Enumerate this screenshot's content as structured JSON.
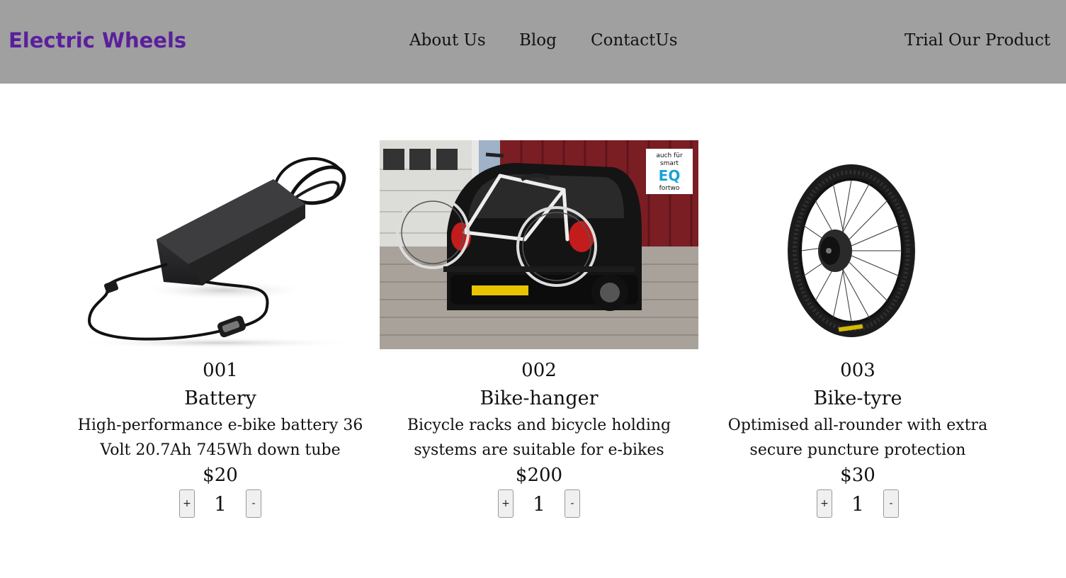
{
  "header": {
    "brand": "Electric Wheels",
    "nav": [
      "About Us",
      "Blog",
      "ContactUs"
    ],
    "cta": "Trial Our Product",
    "colors": {
      "bar": "#a0a0a0",
      "brand": "#5a1f9c"
    }
  },
  "products": [
    {
      "id": "001",
      "name": "Battery",
      "description": "High-performance e-bike battery 36 Volt 20.7Ah 745Wh down tube",
      "price": "$20",
      "quantity": "1",
      "plus": "+",
      "minus": "-",
      "image": "ebike-charger-image"
    },
    {
      "id": "002",
      "name": "Bike-hanger",
      "description": "Bicycle racks and bicycle holding systems are suitable for e-bikes",
      "price": "$200",
      "quantity": "1",
      "plus": "+",
      "minus": "-",
      "image": "car-bike-rack-image",
      "badge": [
        "auch für",
        "smart",
        "EQ",
        "fortwo"
      ]
    },
    {
      "id": "003",
      "name": "Bike-tyre",
      "description": "Optimised all-rounder with extra secure puncture protection",
      "price": "$30",
      "quantity": "1",
      "plus": "+",
      "minus": "-",
      "image": "hub-motor-wheel-image"
    }
  ]
}
